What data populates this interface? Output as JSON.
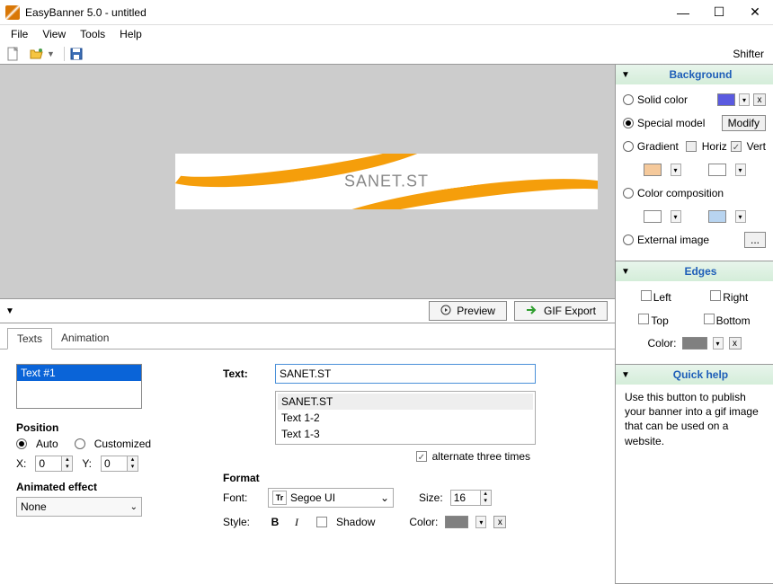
{
  "titlebar": {
    "title": "EasyBanner 5.0 - untitled"
  },
  "menubar": {
    "items": [
      "File",
      "View",
      "Tools",
      "Help"
    ]
  },
  "toolbar": {
    "shifter": "Shifter"
  },
  "banner": {
    "text": "SANET.ST"
  },
  "midbar": {
    "preview": "Preview",
    "gif_export": "GIF Export"
  },
  "tabs": {
    "texts": "Texts",
    "animation": "Animation"
  },
  "text_panel": {
    "list_item": "Text #1",
    "text_label": "Text:",
    "text_value": "SANET.ST",
    "suggestions": [
      "SANET.ST",
      "Text 1-2",
      "Text 1-3"
    ],
    "alternate": "alternate three times",
    "position_label": "Position",
    "auto": "Auto",
    "customized": "Customized",
    "x_label": "X:",
    "x_value": "0",
    "y_label": "Y:",
    "y_value": "0",
    "animated_label": "Animated effect",
    "animated_value": "None",
    "format_label": "Format",
    "font_label": "Font:",
    "font_value": "Segoe UI",
    "size_label": "Size:",
    "size_value": "16",
    "style_label": "Style:",
    "shadow_label": "Shadow",
    "color_label": "Color:",
    "color_value": "#808080"
  },
  "background": {
    "title": "Background",
    "solid": "Solid color",
    "solid_color": "#5a5ae0",
    "special": "Special model",
    "modify": "Modify",
    "gradient": "Gradient",
    "horiz": "Horiz",
    "vert": "Vert",
    "grad_c1": "#f5c99b",
    "grad_c2": "#ffffff",
    "composition": "Color composition",
    "comp_c1": "#ffffff",
    "comp_c2": "#b8d4f0",
    "external": "External image",
    "browse": "..."
  },
  "edges": {
    "title": "Edges",
    "left": "Left",
    "right": "Right",
    "top": "Top",
    "bottom": "Bottom",
    "color_label": "Color:",
    "color_value": "#808080"
  },
  "quickhelp": {
    "title": "Quick help",
    "body": "Use this button to publish your banner into a gif image that can be used on a website."
  }
}
